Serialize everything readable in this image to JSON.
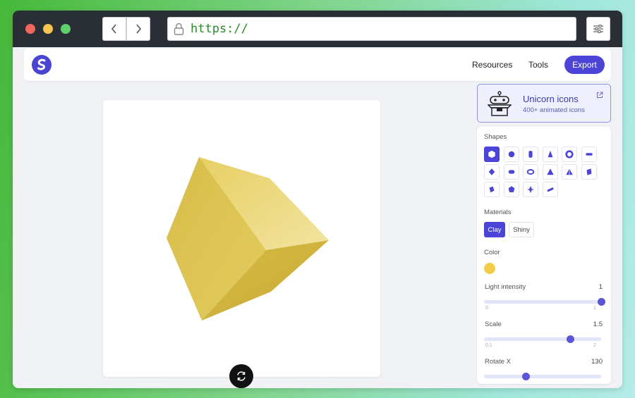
{
  "browser": {
    "url": "https://"
  },
  "header": {
    "nav_links": [
      "Resources",
      "Tools"
    ],
    "export_label": "Export"
  },
  "promo": {
    "title": "Unicorn icons",
    "subtitle": "400+ animated icons"
  },
  "panel": {
    "shapes_label": "Shapes",
    "shapes": [
      "hexagon-shape",
      "sphere-shape",
      "cylinder-shape",
      "cone-shape",
      "torus-shape",
      "capsule-shape",
      "diamond-shape",
      "pill-shape",
      "ring-shape",
      "pyramid-shape",
      "tetrahedron-shape",
      "prism-shape",
      "box-shape",
      "dodecahedron-shape",
      "star-shape",
      "rod-shape"
    ],
    "active_shape": 0,
    "materials_label": "Materials",
    "materials": [
      "Clay",
      "Shiny"
    ],
    "active_material": "Clay",
    "color_label": "Color",
    "color": "#f2cd4b",
    "sliders": [
      {
        "label": "Light intensity",
        "value": "1",
        "min": "0",
        "max": "1",
        "fraction": 1.0
      },
      {
        "label": "Scale",
        "value": "1.5",
        "min": "0.1",
        "max": "2",
        "fraction": 0.74
      },
      {
        "label": "Rotate X",
        "value": "130",
        "fraction": 0.36
      }
    ]
  },
  "colors": {
    "accent": "#4b44d6",
    "cube_yellow": "#e8d06a"
  }
}
